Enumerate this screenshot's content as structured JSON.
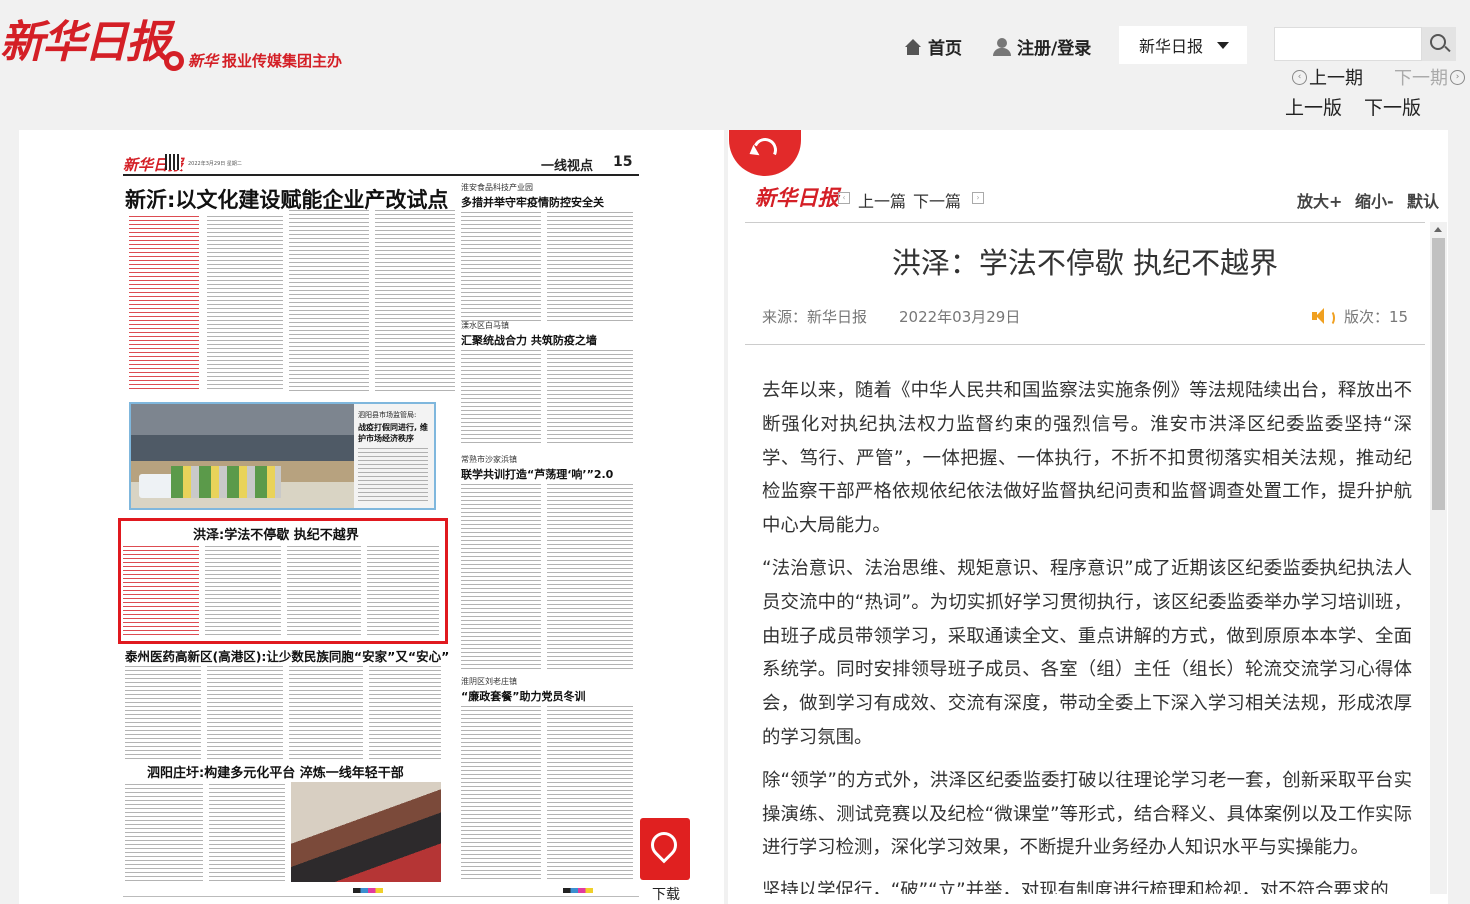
{
  "header": {
    "logo": "新华日报",
    "logo_sub_mark": "新华",
    "logo_sub": "报业传媒集团主办",
    "nav_home": "首页",
    "nav_login": "注册/登录",
    "paper_selected": "新华日报",
    "search_placeholder": "",
    "prev_issue": "上一期",
    "next_issue": "下一期",
    "prev_edition": "上一版",
    "next_edition": "下一版"
  },
  "page": {
    "logo": "新华日报",
    "date_line": "2022年3月29日 星期二",
    "section": "一线视点",
    "page_number": "15",
    "headline_main": "新沂:以文化建设赋能企业产改试点",
    "headline_food": "淮安食品科技产业园",
    "headline_food_sub": "多措并举守牢疫情防控安全关",
    "headline_lishui_kicker": "溧水区白马镇",
    "headline_lishui": "汇聚统战合力 共筑防疫之墙",
    "photo_caption_kicker": "泗阳县市场监管局:",
    "photo_caption": "战疫打假同进行, 维护市场经济秩序",
    "headline_changshu_kicker": "常熟市沙家浜镇",
    "headline_changshu": "联学共训打造“芦荡理‘响’”2.0",
    "headline_hongze": "洪泽:学法不停歇 执纪不越界",
    "headline_taizhou": "泰州医药高新区(高港区):让少数民族同胞“安家”又“安心”",
    "headline_huaiyin_kicker": "淮阴区刘老庄镇",
    "headline_huaiyin": "“廉政套餐”助力党员冬训",
    "headline_siyang": "泗阳庄圩:构建多元化平台 淬炼一线年轻干部",
    "download_label": "下载"
  },
  "article": {
    "logo": "新华日报",
    "prev": "上一篇",
    "next": "下一篇",
    "zoom_in": "放大+",
    "zoom_out": "缩小-",
    "zoom_default": "默认",
    "title": "洪泽：学法不停歇 执纪不越界",
    "source": "来源：新华日报",
    "date": "2022年03月29日",
    "edition": "版次：15",
    "paragraphs": [
      "去年以来，随着《中华人民共和国监察法实施条例》等法规陆续出台，释放出不断强化对执纪执法权力监督约束的强烈信号。淮安市洪泽区纪委监委坚持“深学、笃行、严管”，一体把握、一体执行，不折不扣贯彻落实相关法规，推动纪检监察干部严格依规依纪依法做好监督执纪问责和监督调查处置工作，提升护航中心大局能力。",
      "“法治意识、法治思维、规矩意识、程序意识”成了近期该区纪委监委执纪执法人员交流中的“热词”。为切实抓好学习贯彻执行，该区纪委监委举办学习培训班，由班子成员带领学习，采取通读全文、重点讲解的方式，做到原原本本学、全面系统学。同时安排领导班子成员、各室（组）主任（组长）轮流交流学习心得体会，做到学习有成效、交流有深度，带动全委上下深入学习相关法规，形成浓厚的学习氛围。",
      "除“领学”的方式外，洪泽区纪委监委打破以往理论学习老一套，创新采取平台实操演练、测试竞赛以及纪检“微课堂”等形式，结合释义、具体案例以及工作实际进行学习检测，深化学习效果，不断提升业务经办人知识水平与实操能力。",
      "坚持以学促行，“破”“立”并举，对现有制度进行梳理和检视，对不符合要求的"
    ]
  }
}
